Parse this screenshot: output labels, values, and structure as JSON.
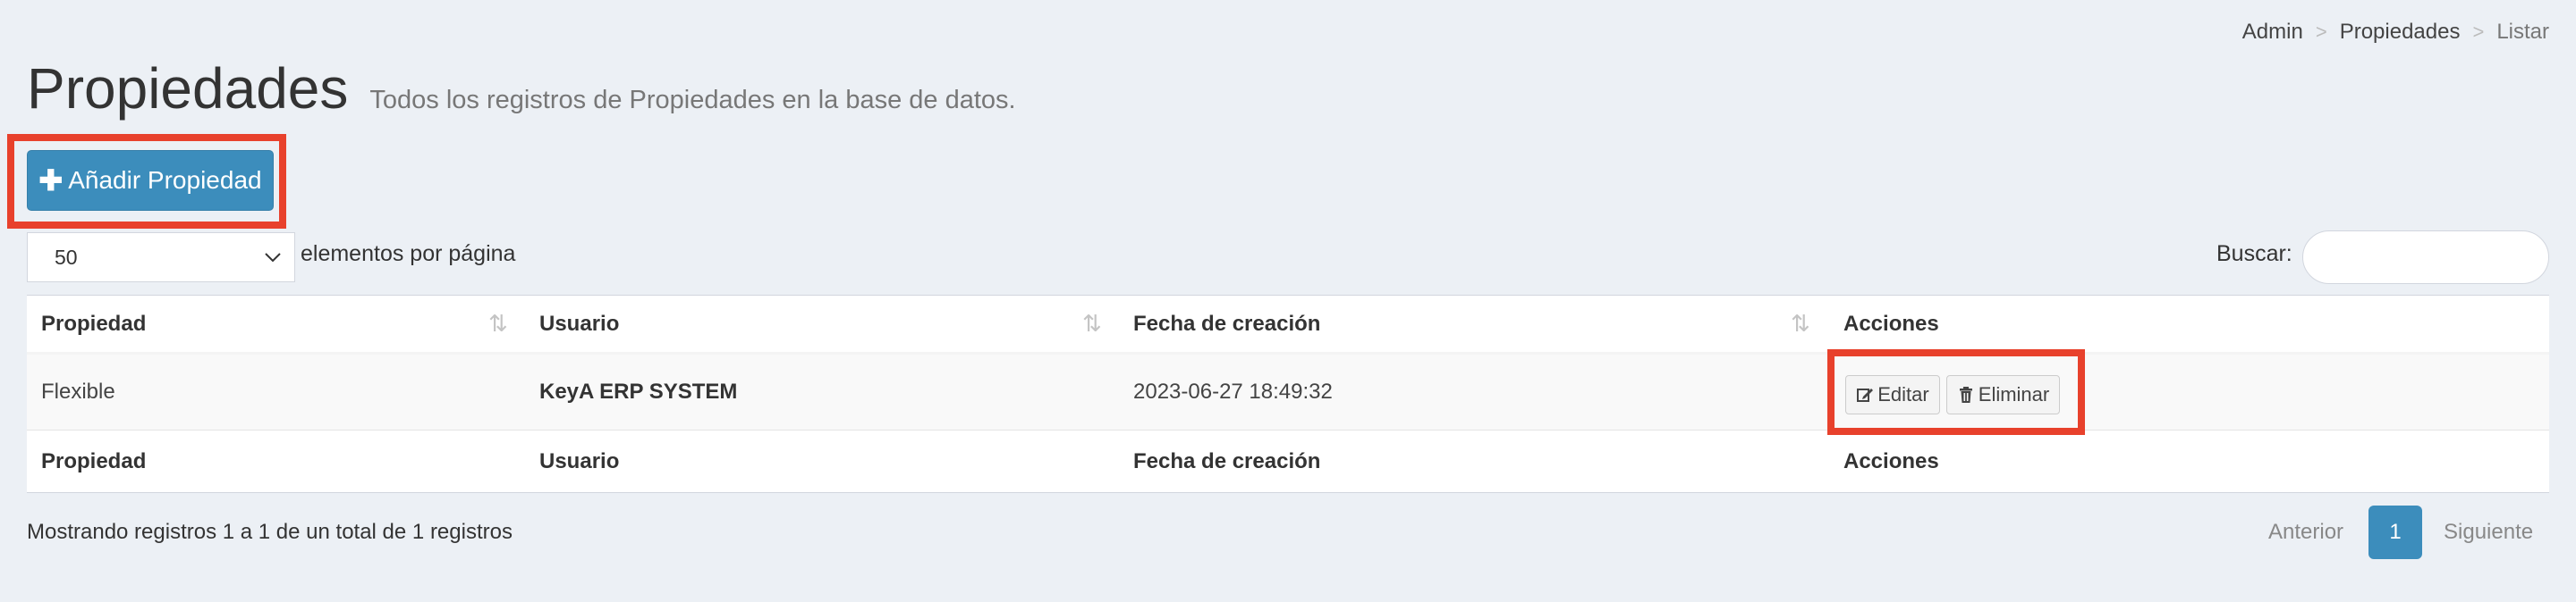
{
  "breadcrumb": {
    "items": [
      "Admin",
      "Propiedades",
      "Listar"
    ],
    "separator": ">"
  },
  "header": {
    "title": "Propiedades",
    "subtitle": "Todos los registros de Propiedades en la base de datos."
  },
  "toolbar": {
    "add_label": "Añadir Propiedad",
    "add_icon": "plus-icon"
  },
  "length": {
    "value": "50",
    "label": "elementos por página"
  },
  "search": {
    "label": "Buscar:",
    "value": "",
    "placeholder": ""
  },
  "table": {
    "columns": [
      "Propiedad",
      "Usuario",
      "Fecha de creación",
      "Acciones"
    ],
    "rows": [
      {
        "propiedad": "Flexible",
        "usuario": "KeyA ERP SYSTEM",
        "fecha": "2023-06-27 18:49:32"
      }
    ],
    "actions": {
      "edit": "Editar",
      "delete": "Eliminar"
    }
  },
  "footer": {
    "info": "Mostrando registros 1 a 1 de un total de 1 registros",
    "prev": "Anterior",
    "current_page": "1",
    "next": "Siguiente"
  },
  "colors": {
    "primary": "#3c8dbc",
    "highlight": "#e8412c",
    "background": "#ecf0f5"
  }
}
